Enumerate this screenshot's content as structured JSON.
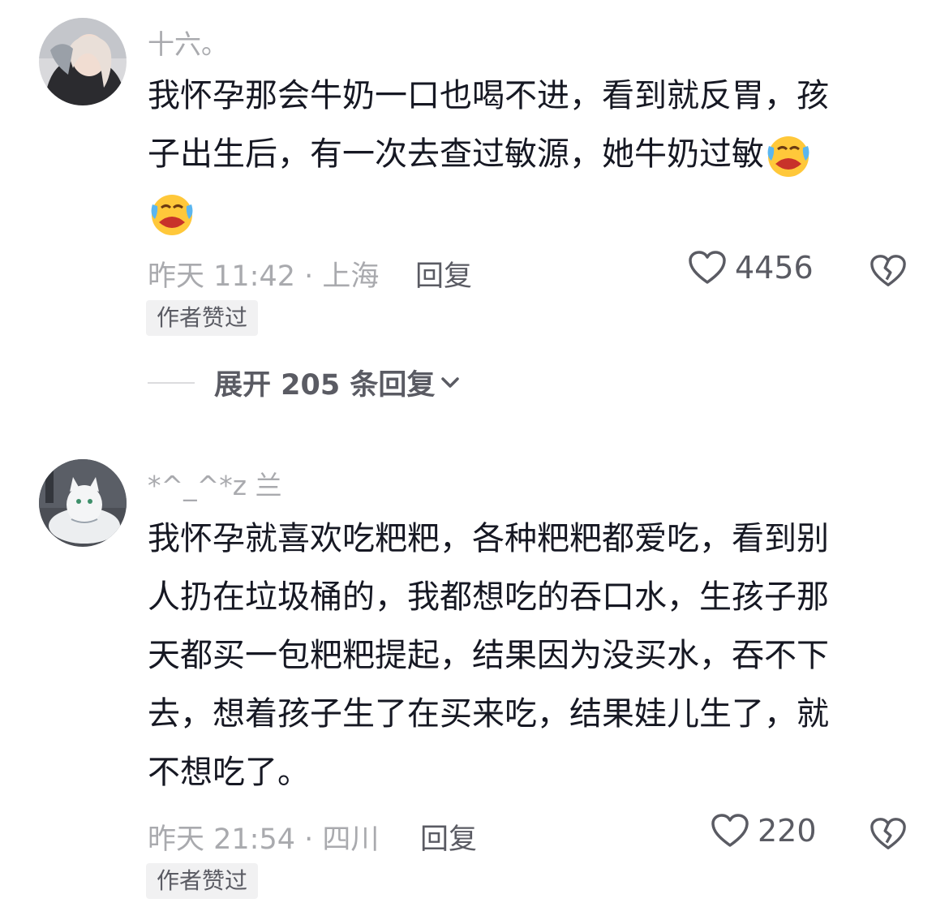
{
  "comments": [
    {
      "username": "十六。",
      "lines": [
        "我怀孕那会牛奶一口也喝不进，看到就反胃，孩",
        "子出生后，有一次去查过敏源，她牛奶过敏"
      ],
      "emoji": "crying-laughing-emoji",
      "time_location": "昨天 11:42 · 上海",
      "reply_label": "回复",
      "like_count": "4456",
      "badge": "作者赞过",
      "expand_label": "展开 205 条回复"
    },
    {
      "username": "*^_^*z 兰",
      "lines": [
        "我怀孕就喜欢吃粑粑，各种粑粑都爱吃，看到别",
        "人扔在垃圾桶的，我都想吃的吞口水，生孩子那",
        "天都买一包粑粑提起，结果因为没买水，吞不下",
        "去，想着孩子生了在买来吃，结果娃儿生了，就",
        "不想吃了。"
      ],
      "time_location": "昨天 21:54 · 四川",
      "reply_label": "回复",
      "like_count": "220",
      "badge": "作者赞过"
    }
  ],
  "icons": {
    "like": "heart-outline-icon",
    "dislike": "broken-heart-icon",
    "expand": "chevron-down-icon"
  }
}
